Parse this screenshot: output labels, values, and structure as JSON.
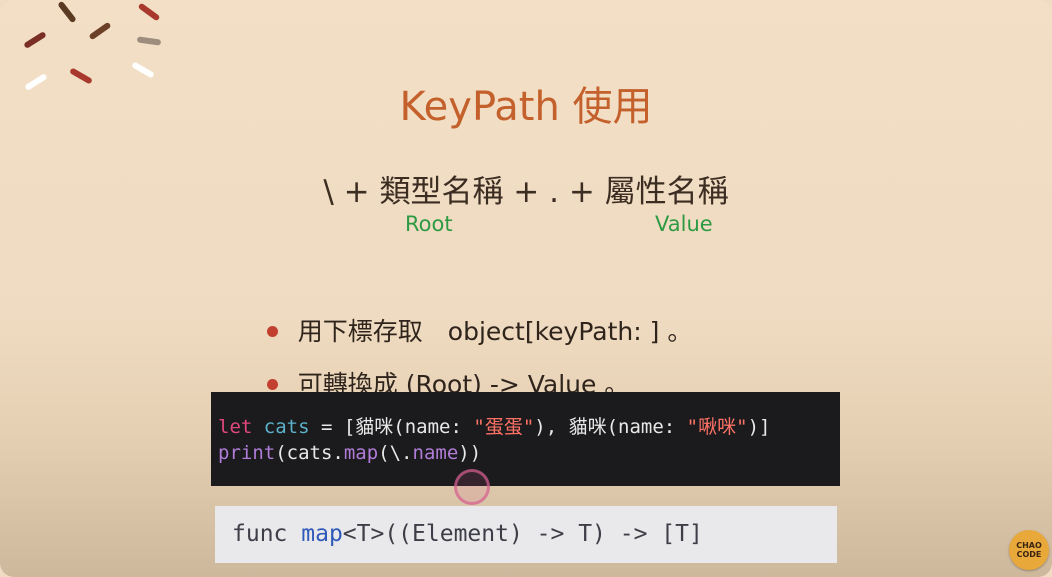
{
  "slide": {
    "title": "KeyPath 使用",
    "formula": "\\ + 類型名稱 + . + 屬性名稱",
    "annotations": {
      "root": "Root",
      "value": "Value"
    },
    "bullets": [
      "用下標存取　object[keyPath: ] 。",
      "可轉換成 (Root) -> Value 。"
    ]
  },
  "code": {
    "line1": {
      "kw_let": "let",
      "var_cats": "cats",
      "mid1": " = [貓咪(name: ",
      "str1": "\"蛋蛋\"",
      "mid2": "), 貓咪(name: ",
      "str2": "\"啾咪\"",
      "end": ")]"
    },
    "line2": {
      "fn_print": "print",
      "mid1": "(cats.",
      "fn_map": "map",
      "mid2": "(\\.",
      "prop_name": "name",
      "end": "))"
    }
  },
  "signature": {
    "prefix": "func ",
    "fn_name": "map",
    "rest": "<T>((Element) -> T) -> [T]"
  },
  "logo": {
    "line1": "CHAO",
    "line2": "CODE"
  },
  "colors": {
    "title": "#c4602b",
    "annotation": "#2e9a44",
    "bullet_dot": "#c2402f",
    "code_bg": "#1b1b1d",
    "keyword": "#e2487d",
    "string": "#ff7265"
  }
}
